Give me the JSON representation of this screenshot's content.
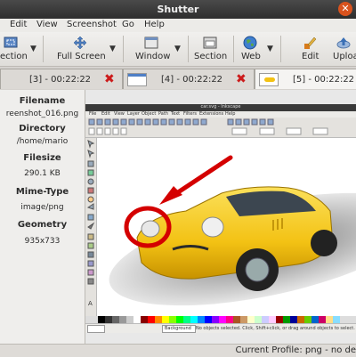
{
  "window": {
    "title": "Shutter"
  },
  "menu": [
    "Edit",
    "View",
    "Screenshot",
    "Go",
    "Help"
  ],
  "toolbar": {
    "selection_label": "ection",
    "fullscreen_label": "Full Screen",
    "window_label": "Window",
    "section_label": "Section",
    "web_label": "Web",
    "edit_label": "Edit",
    "upload_label": "Uploa"
  },
  "tabs": [
    {
      "label": "[3] - 00:22:22"
    },
    {
      "label": "[4] - 00:22:22"
    },
    {
      "label": "[5] - 00:22:22"
    }
  ],
  "sidebar": {
    "filename_h": "Filename",
    "filename_v": "reenshot_016.png",
    "directory_h": "Directory",
    "directory_v": "/home/mario",
    "filesize_h": "Filesize",
    "filesize_v": "290.1 KB",
    "mime_h": "Mime-Type",
    "mime_v": "image/png",
    "geometry_h": "Geometry",
    "geometry_v": "935x733"
  },
  "preview": {
    "inkscape_title": "car.svg - Inkscape",
    "inkscape_menu": [
      "File",
      "Edit",
      "View",
      "Layer",
      "Object",
      "Path",
      "Text",
      "Filters",
      "Extensions",
      "Help"
    ],
    "inkscape_status": "No objects selected. Click, Shift+click, or drag around objects to select.",
    "inkscape_layer": "Background"
  },
  "status": {
    "text": "Current Profile: png - no de"
  },
  "colors": {
    "titlebar": "#3a3a3a",
    "accent_red": "#d40000",
    "car": "#f3c214"
  },
  "icons": [
    "close-icon",
    "selection-icon",
    "fullscreen-icon",
    "window-icon",
    "section-icon",
    "web-icon",
    "edit-icon",
    "upload-icon",
    "delete-icon"
  ]
}
